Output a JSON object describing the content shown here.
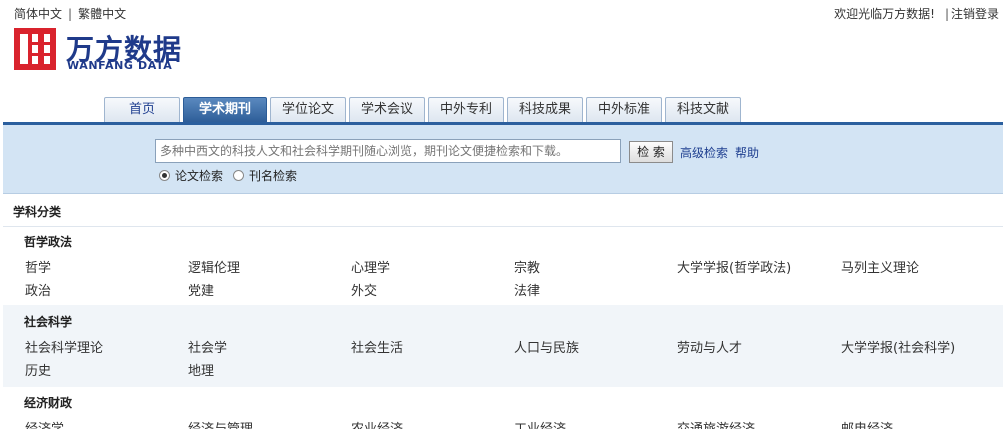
{
  "lang": {
    "simplified": "简体中文",
    "separator": "|",
    "traditional": "繁體中文"
  },
  "account": {
    "welcome": "欢迎光临万方数据!",
    "separator": "|",
    "logout": "注销登录"
  },
  "logo": {
    "cn": "万方数据",
    "en": "WANFANG DATA",
    "mark_color": "#d9232d"
  },
  "tabs": [
    "首页",
    "学术期刊",
    "学位论文",
    "学术会议",
    "中外专利",
    "科技成果",
    "中外标准",
    "科技文献"
  ],
  "active_tab": "学术期刊",
  "search": {
    "placeholder": "多种中西文的科技人文和社会科学期刊随心浏览，期刊论文便捷检索和下载。",
    "button": "检 索",
    "advanced": "高级检索",
    "help": "帮助",
    "options": [
      "论文检索",
      "刊名检索"
    ],
    "selected_option": "论文检索"
  },
  "category": {
    "header": "学科分类",
    "sections": [
      {
        "title": "哲学政法",
        "items": [
          "哲学",
          "逻辑伦理",
          "心理学",
          "宗教",
          "大学学报(哲学政法)",
          "马列主义理论",
          "政治",
          "党建",
          "外交",
          "法律"
        ]
      },
      {
        "title": "社会科学",
        "items": [
          "社会科学理论",
          "社会学",
          "社会生活",
          "人口与民族",
          "劳动与人才",
          "大学学报(社会科学)",
          "历史",
          "地理"
        ]
      },
      {
        "title": "经济财政",
        "items": [
          "经济学",
          "经济与管理",
          "农业经济",
          "工业经济",
          "交通旅游经济",
          "邮电经济"
        ]
      }
    ]
  },
  "colors": {
    "tab_active": "#2c5c97",
    "search_bg": "#d3e4f4",
    "link": "#1f3f90"
  }
}
